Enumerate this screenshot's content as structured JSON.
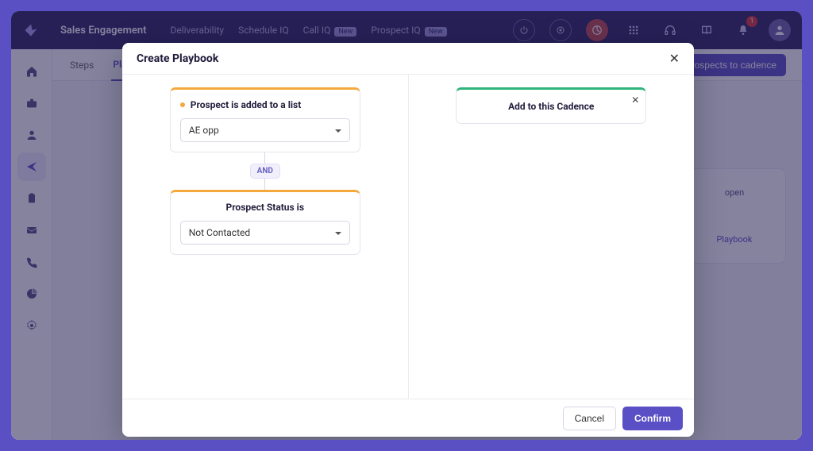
{
  "topnav": {
    "brand": "Sales Engagement",
    "items": [
      {
        "label": "Deliverability"
      },
      {
        "label": "Schedule IQ"
      },
      {
        "label": "Call IQ",
        "badge": "New"
      },
      {
        "label": "Prospect IQ",
        "badge": "New"
      }
    ],
    "notif_count": "1"
  },
  "subtabs": {
    "items": [
      {
        "label": "Steps",
        "active": false
      },
      {
        "label": "Playbooks",
        "active": true
      }
    ],
    "primary_button": "Add prospects to cadence"
  },
  "ghost_card": {
    "line1": "open",
    "link": "Playbook"
  },
  "modal": {
    "title": "Create Playbook",
    "condition1": {
      "title": "Prospect is added to a list",
      "value": "AE opp"
    },
    "connector": "AND",
    "condition2": {
      "title": "Prospect Status is",
      "value": "Not Contacted"
    },
    "action": {
      "label": "Add to this Cadence"
    },
    "cancel": "Cancel",
    "confirm": "Confirm"
  }
}
